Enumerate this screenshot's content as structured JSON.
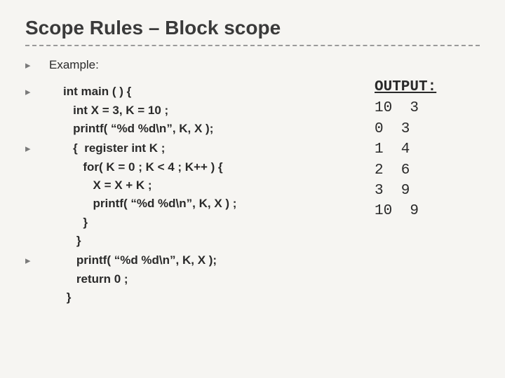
{
  "title": "Scope Rules – Block scope",
  "bullets": {
    "b0": "Example:",
    "code1": "int main ( ) {\n   int X = 3, K = 10 ;\n   printf( “%d %d\\n”, K, X );",
    "code2": "   {  register int K ;\n      for( K = 0 ; K < 4 ; K++ ) {\n         X = X + K ;\n         printf( “%d %d\\n”, K, X ) ;\n      }\n    }",
    "code3": "    printf( “%d %d\\n”, K, X );\n    return 0 ;\n }"
  },
  "output": {
    "label": "OUTPUT:",
    "lines": "10  3\n0  3\n1  4\n2  6\n3  9\n10  9"
  },
  "glyphs": {
    "tri": "▸"
  }
}
